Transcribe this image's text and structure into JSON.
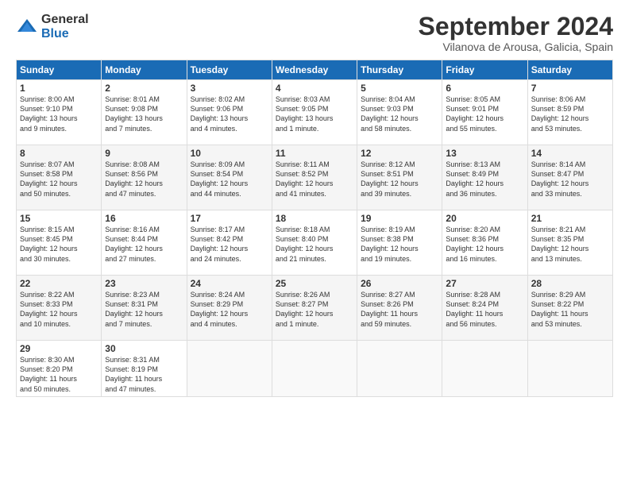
{
  "logo": {
    "general": "General",
    "blue": "Blue"
  },
  "title": "September 2024",
  "location": "Vilanova de Arousa, Galicia, Spain",
  "headers": [
    "Sunday",
    "Monday",
    "Tuesday",
    "Wednesday",
    "Thursday",
    "Friday",
    "Saturday"
  ],
  "weeks": [
    [
      {
        "day": "1",
        "info": "Sunrise: 8:00 AM\nSunset: 9:10 PM\nDaylight: 13 hours\nand 9 minutes."
      },
      {
        "day": "2",
        "info": "Sunrise: 8:01 AM\nSunset: 9:08 PM\nDaylight: 13 hours\nand 7 minutes."
      },
      {
        "day": "3",
        "info": "Sunrise: 8:02 AM\nSunset: 9:06 PM\nDaylight: 13 hours\nand 4 minutes."
      },
      {
        "day": "4",
        "info": "Sunrise: 8:03 AM\nSunset: 9:05 PM\nDaylight: 13 hours\nand 1 minute."
      },
      {
        "day": "5",
        "info": "Sunrise: 8:04 AM\nSunset: 9:03 PM\nDaylight: 12 hours\nand 58 minutes."
      },
      {
        "day": "6",
        "info": "Sunrise: 8:05 AM\nSunset: 9:01 PM\nDaylight: 12 hours\nand 55 minutes."
      },
      {
        "day": "7",
        "info": "Sunrise: 8:06 AM\nSunset: 8:59 PM\nDaylight: 12 hours\nand 53 minutes."
      }
    ],
    [
      {
        "day": "8",
        "info": "Sunrise: 8:07 AM\nSunset: 8:58 PM\nDaylight: 12 hours\nand 50 minutes."
      },
      {
        "day": "9",
        "info": "Sunrise: 8:08 AM\nSunset: 8:56 PM\nDaylight: 12 hours\nand 47 minutes."
      },
      {
        "day": "10",
        "info": "Sunrise: 8:09 AM\nSunset: 8:54 PM\nDaylight: 12 hours\nand 44 minutes."
      },
      {
        "day": "11",
        "info": "Sunrise: 8:11 AM\nSunset: 8:52 PM\nDaylight: 12 hours\nand 41 minutes."
      },
      {
        "day": "12",
        "info": "Sunrise: 8:12 AM\nSunset: 8:51 PM\nDaylight: 12 hours\nand 39 minutes."
      },
      {
        "day": "13",
        "info": "Sunrise: 8:13 AM\nSunset: 8:49 PM\nDaylight: 12 hours\nand 36 minutes."
      },
      {
        "day": "14",
        "info": "Sunrise: 8:14 AM\nSunset: 8:47 PM\nDaylight: 12 hours\nand 33 minutes."
      }
    ],
    [
      {
        "day": "15",
        "info": "Sunrise: 8:15 AM\nSunset: 8:45 PM\nDaylight: 12 hours\nand 30 minutes."
      },
      {
        "day": "16",
        "info": "Sunrise: 8:16 AM\nSunset: 8:44 PM\nDaylight: 12 hours\nand 27 minutes."
      },
      {
        "day": "17",
        "info": "Sunrise: 8:17 AM\nSunset: 8:42 PM\nDaylight: 12 hours\nand 24 minutes."
      },
      {
        "day": "18",
        "info": "Sunrise: 8:18 AM\nSunset: 8:40 PM\nDaylight: 12 hours\nand 21 minutes."
      },
      {
        "day": "19",
        "info": "Sunrise: 8:19 AM\nSunset: 8:38 PM\nDaylight: 12 hours\nand 19 minutes."
      },
      {
        "day": "20",
        "info": "Sunrise: 8:20 AM\nSunset: 8:36 PM\nDaylight: 12 hours\nand 16 minutes."
      },
      {
        "day": "21",
        "info": "Sunrise: 8:21 AM\nSunset: 8:35 PM\nDaylight: 12 hours\nand 13 minutes."
      }
    ],
    [
      {
        "day": "22",
        "info": "Sunrise: 8:22 AM\nSunset: 8:33 PM\nDaylight: 12 hours\nand 10 minutes."
      },
      {
        "day": "23",
        "info": "Sunrise: 8:23 AM\nSunset: 8:31 PM\nDaylight: 12 hours\nand 7 minutes."
      },
      {
        "day": "24",
        "info": "Sunrise: 8:24 AM\nSunset: 8:29 PM\nDaylight: 12 hours\nand 4 minutes."
      },
      {
        "day": "25",
        "info": "Sunrise: 8:26 AM\nSunset: 8:27 PM\nDaylight: 12 hours\nand 1 minute."
      },
      {
        "day": "26",
        "info": "Sunrise: 8:27 AM\nSunset: 8:26 PM\nDaylight: 11 hours\nand 59 minutes."
      },
      {
        "day": "27",
        "info": "Sunrise: 8:28 AM\nSunset: 8:24 PM\nDaylight: 11 hours\nand 56 minutes."
      },
      {
        "day": "28",
        "info": "Sunrise: 8:29 AM\nSunset: 8:22 PM\nDaylight: 11 hours\nand 53 minutes."
      }
    ],
    [
      {
        "day": "29",
        "info": "Sunrise: 8:30 AM\nSunset: 8:20 PM\nDaylight: 11 hours\nand 50 minutes."
      },
      {
        "day": "30",
        "info": "Sunrise: 8:31 AM\nSunset: 8:19 PM\nDaylight: 11 hours\nand 47 minutes."
      },
      {
        "day": "",
        "info": ""
      },
      {
        "day": "",
        "info": ""
      },
      {
        "day": "",
        "info": ""
      },
      {
        "day": "",
        "info": ""
      },
      {
        "day": "",
        "info": ""
      }
    ]
  ]
}
